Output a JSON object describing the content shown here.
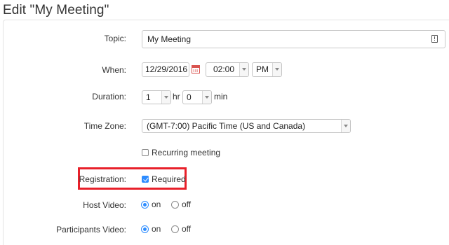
{
  "page": {
    "title": "Edit \"My Meeting\""
  },
  "form": {
    "topic": {
      "label": "Topic:",
      "value": "My Meeting"
    },
    "when": {
      "label": "When:",
      "date": "12/29/2016",
      "time": "02:00",
      "ampm": "PM"
    },
    "duration": {
      "label": "Duration:",
      "hours": "1",
      "hr_unit": "hr",
      "minutes": "0",
      "min_unit": "min"
    },
    "timezone": {
      "label": "Time Zone:",
      "value": "(GMT-7:00) Pacific Time (US and Canada)"
    },
    "recurring": {
      "label": "Recurring meeting",
      "checked": false
    },
    "registration": {
      "label": "Registration:",
      "option_label": "Required",
      "checked": true
    },
    "host_video": {
      "label": "Host Video:",
      "on_label": "on",
      "off_label": "off",
      "selected": "on"
    },
    "participants_video": {
      "label": "Participants Video:",
      "on_label": "on",
      "off_label": "off",
      "selected": "on"
    }
  },
  "icons": {
    "topic_field": "document-info-icon",
    "date_picker": "calendar-icon",
    "dropdown": "chevron-down-icon"
  },
  "colors": {
    "accent": "#2d8cff",
    "highlight_box": "#e8202a",
    "calendar_icon": "#d9534f"
  }
}
